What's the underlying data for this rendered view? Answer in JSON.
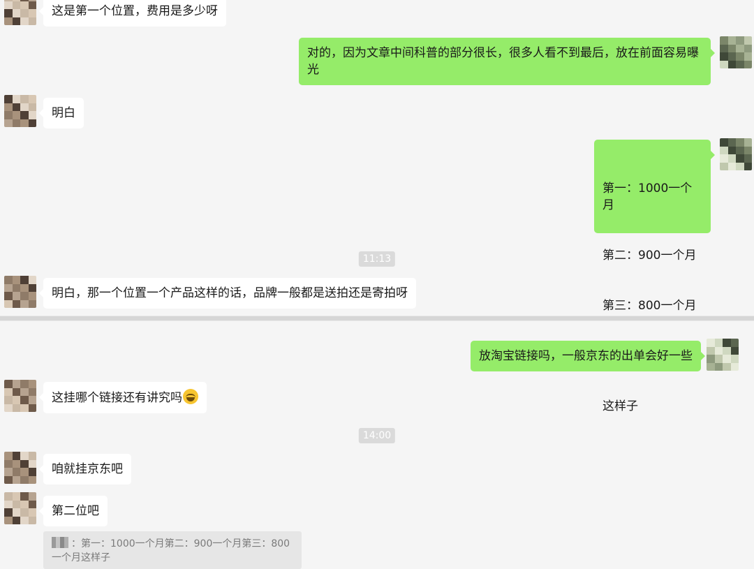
{
  "messages": [
    {
      "side": "left",
      "text": "这是第一个位置，费用是多少呀"
    },
    {
      "side": "right",
      "text": "对的，因为文章中间科普的部分很长，很多人看不到最后，放在前面容易曝光"
    },
    {
      "side": "left",
      "text": "明白"
    },
    {
      "side": "right",
      "line1": "第一：1000一个月",
      "line2": "第二：900一个月",
      "line3": "第三：800一个月",
      "line4": "这样子"
    },
    {
      "side": "left",
      "text": "明白，那一个位置一个产品这样的话，品牌一般都是送拍还是寄拍呀"
    },
    {
      "side": "right",
      "text": "放淘宝链接吗，一般京东的出单会好一些"
    },
    {
      "side": "left",
      "text": "这挂哪个链接还有讲究吗",
      "emoji": "laughing-tears-emoji"
    },
    {
      "side": "left",
      "text": "咱就挂京东吧"
    },
    {
      "side": "left",
      "text": "第二位吧"
    }
  ],
  "timestamps": [
    "11:13",
    "14:00"
  ],
  "quote": {
    "text": "：第一：1000一个月第二：900一个月第三：800一个月这样子"
  },
  "colors": {
    "background": "#f5f5f5",
    "bubble_left": "#ffffff",
    "bubble_right": "#95ec69",
    "time_badge": "#dadada"
  }
}
